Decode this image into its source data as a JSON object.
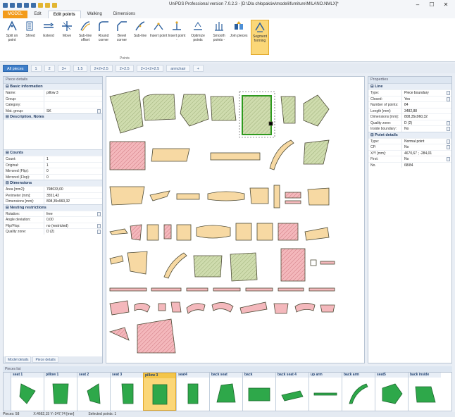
{
  "window": {
    "title": "UniPDS Professional version 7.0.2.3 - [D:\\Dla chłopaków\\modeli\\furniture\\MILANO.NMLX]*"
  },
  "ribbon_tabs": [
    "MODEL",
    "Edit",
    "Edit points",
    "Walking",
    "Dimensions"
  ],
  "ribbon_tools": [
    {
      "label": "Split on point"
    },
    {
      "label": "Shred"
    },
    {
      "label": "Extend"
    },
    {
      "label": "Move"
    },
    {
      "label": "Sub-line offset"
    },
    {
      "label": "Round corner"
    },
    {
      "label": "Bevel corner"
    },
    {
      "label": "Sub-line"
    },
    {
      "label": "Insert point"
    },
    {
      "label": "Insert point -"
    },
    {
      "label": "Optimize points"
    },
    {
      "label": "Smooth points -"
    },
    {
      "label": "Join pieces"
    },
    {
      "label": "Segment forming"
    }
  ],
  "ribbon_group_label": "Points",
  "filter_tabs": [
    "All pieces",
    "1",
    "2",
    "3+",
    "1.5",
    "2+2+2.5",
    "2+2.5",
    "2+1+2+2.5",
    "armchair"
  ],
  "left_panel": {
    "header": "Piece details",
    "basic": {
      "title": "Basic information",
      "rows": [
        {
          "k": "Name:",
          "v": "pillow 3"
        },
        {
          "k": "Group:",
          "v": ""
        },
        {
          "k": "Category:",
          "v": ""
        },
        {
          "k": "Mat. group:",
          "v": "SK"
        }
      ]
    },
    "description_title": "Description, Notes",
    "counts": {
      "title": "Counts",
      "rows": [
        {
          "k": "Count:",
          "v": "1"
        },
        {
          "k": "Original:",
          "v": "1"
        },
        {
          "k": "Mirrored (Flip):",
          "v": "0"
        },
        {
          "k": "Mirrored (Flop):",
          "v": "0"
        }
      ]
    },
    "dimensions": {
      "title": "Dimensions",
      "rows": [
        {
          "k": "Area [mm2]:",
          "v": "798033,00"
        },
        {
          "k": "Perimeter [mm]:",
          "v": "3551,42"
        },
        {
          "k": "Dimensions [mm]:",
          "v": "808,35x960,32"
        }
      ]
    },
    "nesting": {
      "title": "Nesting restrictions",
      "rows": [
        {
          "k": "Rotation:",
          "v": "free"
        },
        {
          "k": "Angle deviation:",
          "v": "0,00"
        },
        {
          "k": "Flip/Flop:",
          "v": "no (restricted)"
        },
        {
          "k": "Quality zone:",
          "v": "D (2)"
        }
      ]
    },
    "bottom_tabs": [
      "Model details",
      "Piece details"
    ]
  },
  "right_panel": {
    "header": "Properties",
    "line": {
      "title": "Line",
      "rows": [
        {
          "k": "Type:",
          "v": "Piece boundary"
        },
        {
          "k": "Closed:",
          "v": "Yes"
        },
        {
          "k": "Number of points:",
          "v": "84"
        },
        {
          "k": "Length [mm]:",
          "v": "3482,88"
        },
        {
          "k": "Dimensions [mm]:",
          "v": "808,35x960,32"
        },
        {
          "k": "Quality zone:",
          "v": "D (2)"
        },
        {
          "k": "Inside boundary:",
          "v": "No"
        }
      ]
    },
    "point": {
      "title": "Point details",
      "rows": [
        {
          "k": "Type:",
          "v": "Normal point"
        },
        {
          "k": "CP:",
          "v": "No"
        },
        {
          "k": "X/Y [mm]:",
          "v": "4670,67 ; -284,01"
        },
        {
          "k": "First:",
          "v": "No"
        },
        {
          "k": "No.",
          "v": "68/84"
        }
      ]
    }
  },
  "pieces_header": "Pieces list",
  "pieces": [
    {
      "name": "seat 1"
    },
    {
      "name": "pillow 1"
    },
    {
      "name": "seat 2"
    },
    {
      "name": "seat 3"
    },
    {
      "name": "pillow 3"
    },
    {
      "name": "seat4"
    },
    {
      "name": "back seat"
    },
    {
      "name": "back"
    },
    {
      "name": "back seat 4"
    },
    {
      "name": "up arm"
    },
    {
      "name": "back arm"
    },
    {
      "name": "seat5"
    },
    {
      "name": "back inside"
    }
  ],
  "status": {
    "pieces": "Pieces: 58",
    "coords": "X:4662,15 Y:-247,74 [mm]",
    "selected": "Selected points: 1"
  },
  "colors": {
    "accent": "#3d7dc8",
    "model_tab": "#f39b1a",
    "green_piece": "#cfdcae",
    "peach_piece": "#f7d9a3",
    "pink_piece": "#f4b8bc",
    "selected_outline": "#2f9a1f"
  }
}
